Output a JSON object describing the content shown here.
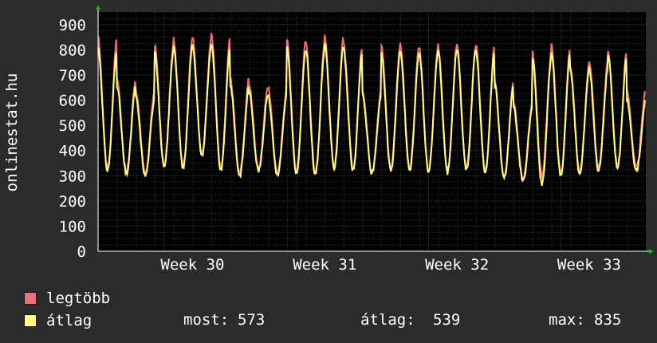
{
  "chart_data": {
    "type": "line",
    "ylabel": "onlinestat.hu",
    "ylim": [
      0,
      950
    ],
    "yticks": [
      0,
      100,
      200,
      300,
      400,
      500,
      600,
      700,
      800,
      900
    ],
    "xticks": [
      "Week 30",
      "Week 31",
      "Week 32",
      "Week 33"
    ],
    "grid": true,
    "days": 29,
    "daily_peak_max": [
      848,
      690,
      640,
      820,
      845,
      850,
      860,
      690,
      660,
      650,
      840,
      830,
      860,
      820,
      640,
      820,
      820,
      810,
      820,
      820,
      820,
      680,
      590,
      790,
      820,
      740,
      760,
      800,
      640
    ],
    "daily_peak_avg": [
      810,
      660,
      610,
      800,
      820,
      820,
      820,
      660,
      630,
      620,
      810,
      800,
      830,
      800,
      620,
      790,
      790,
      790,
      800,
      800,
      800,
      660,
      570,
      770,
      790,
      720,
      730,
      780,
      600
    ],
    "daily_low_max": [
      330,
      315,
      310,
      340,
      340,
      390,
      330,
      310,
      330,
      310,
      315,
      310,
      340,
      330,
      320,
      330,
      330,
      320,
      320,
      330,
      320,
      300,
      290,
      300,
      310,
      315,
      330,
      340,
      330
    ],
    "daily_low_avg": [
      320,
      305,
      300,
      330,
      330,
      380,
      320,
      300,
      320,
      300,
      305,
      300,
      330,
      320,
      310,
      320,
      320,
      310,
      310,
      320,
      310,
      290,
      280,
      265,
      300,
      305,
      320,
      330,
      320
    ],
    "series": [
      {
        "name": "legtöbb",
        "color": "#f0707a"
      },
      {
        "name": "átlag",
        "color": "#ffff80"
      }
    ]
  },
  "legend": {
    "items": [
      {
        "label": "legtöbb",
        "color": "#f0707a"
      },
      {
        "label": "átlag",
        "color": "#ffff80"
      }
    ],
    "most_label": "most:",
    "most_value": "573",
    "atlag_label": "átlag:",
    "atlag_value": "539",
    "max_label": "max:",
    "max_value": "835"
  }
}
